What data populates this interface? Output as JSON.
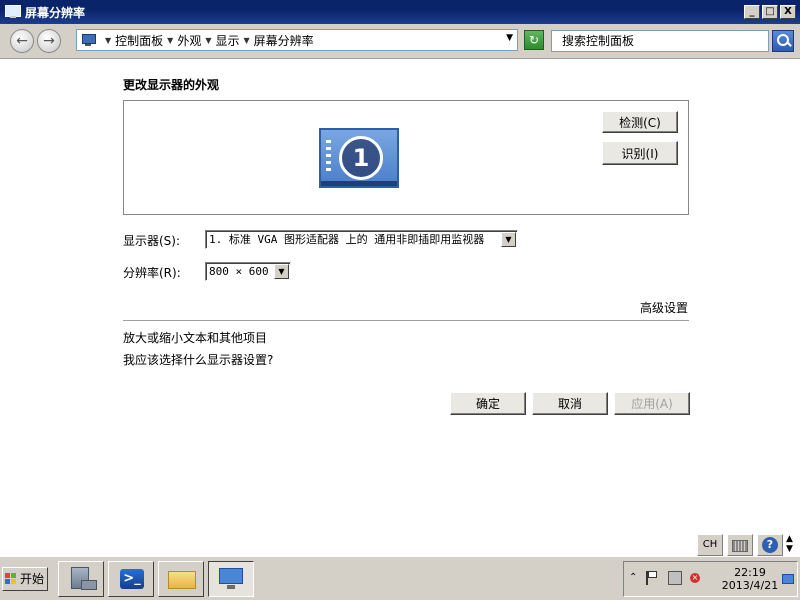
{
  "window": {
    "title": "屏幕分辨率",
    "min_glyph": "_",
    "max_glyph": "□",
    "close_glyph": "X"
  },
  "address": {
    "crumbs": [
      "控制面板",
      "外观",
      "显示",
      "屏幕分辨率"
    ],
    "search_placeholder": "搜索控制面板"
  },
  "main": {
    "heading": "更改显示器的外观",
    "detect_button": "检测(C)",
    "identify_button": "识别(I)",
    "monitor_number": "1",
    "display_label": "显示器(S):",
    "display_value": "1. 标准 VGA 图形适配器 上的 通用非即插即用监视器",
    "resolution_label": "分辨率(R):",
    "resolution_value": "800 × 600",
    "advanced_link": "高级设置",
    "link_text_size": "放大或缩小文本和其他项目",
    "link_which_settings": "我应该选择什么显示器设置?",
    "ok_button": "确定",
    "cancel_button": "取消",
    "apply_button": "应用(A)"
  },
  "langbar": {
    "lang": "CH",
    "help": "?"
  },
  "taskbar": {
    "start_label": "开始",
    "time": "22:19",
    "date": "2013/4/21"
  },
  "colors": {
    "titlebar": "#0a246a",
    "chrome": "#d4d0c8",
    "link": "#000000"
  }
}
